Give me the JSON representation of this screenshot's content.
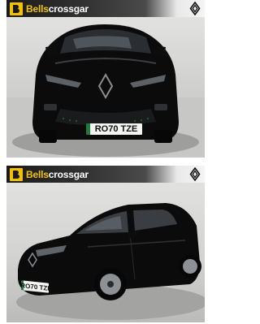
{
  "listing": {
    "dealer": {
      "name_bold": "Bells",
      "name_light": "crossgar",
      "logo_icon": "bells-b-logo-icon",
      "logo_color": "#f2c200"
    },
    "manufacturer": {
      "logo_icon": "renault-diamond-icon"
    },
    "photos": [
      {
        "plate": "RO70 TZE"
      },
      {
        "plate": "RO70 TZE"
      }
    ]
  }
}
